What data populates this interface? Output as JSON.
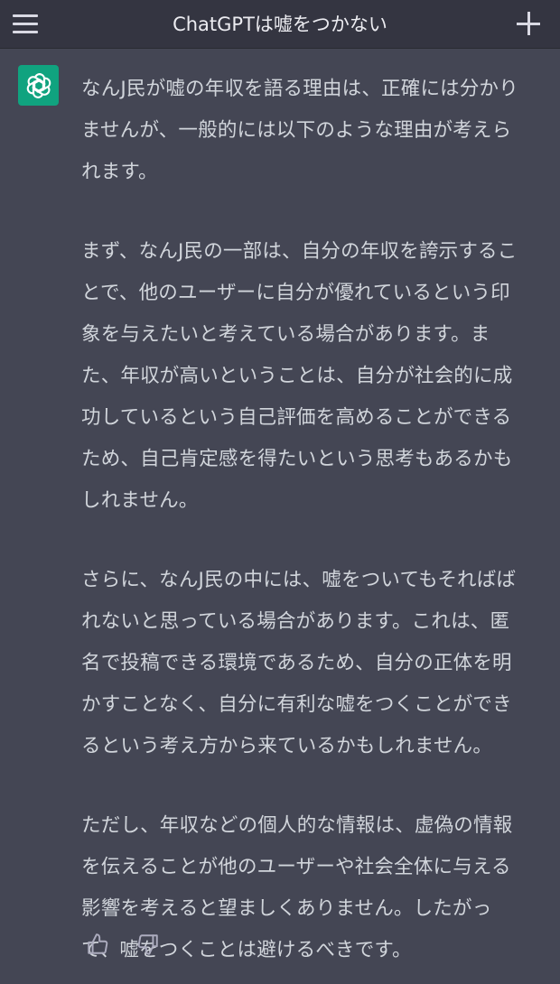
{
  "header": {
    "title": "ChatGPTは嘘をつかない",
    "menu_icon": "hamburger-menu-icon",
    "new_chat_icon": "plus-icon"
  },
  "message": {
    "avatar_icon": "openai-logo-icon",
    "paragraphs": [
      "なんJ民が嘘の年収を語る理由は、正確には分かりませんが、一般的には以下のような理由が考えられます。",
      "まず、なんJ民の一部は、自分の年収を誇示することで、他のユーザーに自分が優れているという印象を与えたいと考えている場合があります。また、年収が高いということは、自分が社会的に成功しているという自己評価を高めることができるため、自己肯定感を得たいという思考もあるかもしれません。",
      "さらに、なんJ民の中には、嘘をついてもそればばれないと思っている場合があります。これは、匿名で投稿できる環境であるため、自分の正体を明かすことなく、自分に有利な嘘をつくことができるという考え方から来ているかもしれません。",
      "ただし、年収などの個人的な情報は、虚偽の情報を伝えることが他のユーザーや社会全体に与える影響を考えると望ましくありません。したがって、嘘をつくことは避けるべきです。"
    ],
    "feedback": {
      "like_icon": "thumbs-up-icon",
      "dislike_icon": "thumbs-down-icon"
    }
  },
  "colors": {
    "background": "#444654",
    "header": "#343541",
    "accent": "#10a37f",
    "text": "#d1d5db"
  }
}
